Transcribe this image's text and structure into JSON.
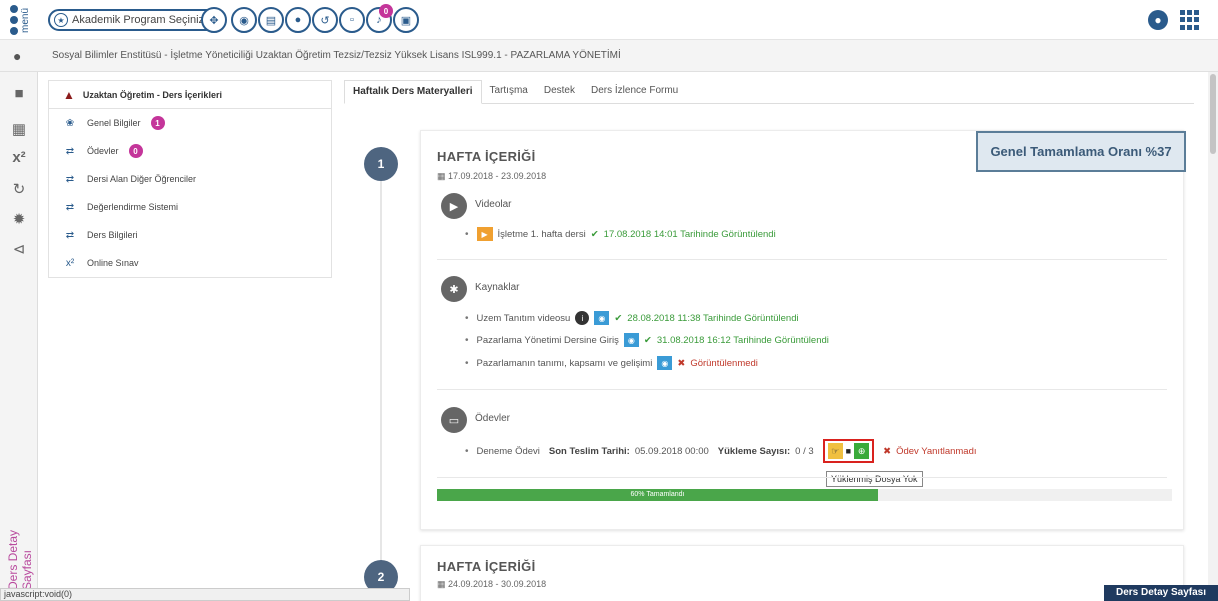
{
  "topbar": {
    "menu_label": "menü",
    "program_select_label": "Akademik Program Seçiniz",
    "notification_count": "0"
  },
  "breadcrumb": "Sosyal Bilimler Enstitüsü - İşletme Yöneticiliği Uzaktan Öğretim Tezsiz/Tezsiz Yüksek Lisans ISL999.1 - PAZARLAMA YÖNETİMİ",
  "rail": {
    "vertical_label": "Ders Detay Sayfası"
  },
  "course_nav": {
    "header": "Uzaktan Öğretim - Ders İçerikleri",
    "items": [
      {
        "label": "Genel Bilgiler",
        "badge": "1"
      },
      {
        "label": "Ödevler",
        "badge": "0"
      },
      {
        "label": "Dersi Alan Diğer Öğrenciler",
        "badge": ""
      },
      {
        "label": "Değerlendirme Sistemi",
        "badge": ""
      },
      {
        "label": "Ders Bilgileri",
        "badge": ""
      },
      {
        "label": "Online Sınav",
        "badge": ""
      }
    ]
  },
  "tabs": [
    {
      "label": "Haftalık Ders Materyalleri",
      "active": true
    },
    {
      "label": "Tartışma",
      "active": false
    },
    {
      "label": "Destek",
      "active": false
    },
    {
      "label": "Ders İzlence Formu",
      "active": false
    }
  ],
  "week1": {
    "number": "1",
    "title": "HAFTA İÇERİĞİ",
    "date_range": "17.09.2018 - 23.09.2018",
    "completion": "Genel Tamamlama Oranı %37",
    "videos_title": "Videolar",
    "video_item": {
      "label": "İşletme 1. hafta dersi",
      "status": "17.08.2018 14:01 Tarihinde Görüntülendi"
    },
    "resources_title": "Kaynaklar",
    "resources": [
      {
        "label": "Uzem Tanıtım videosu",
        "status": "28.08.2018 11:38 Tarihinde Görüntülendi"
      },
      {
        "label": "Pazarlama Yönetimi Dersine Giriş",
        "status": "31.08.2018 16:12 Tarihinde Görüntülendi"
      },
      {
        "label": "Pazarlamanın tanımı, kapsamı ve gelişimi",
        "status": "Görüntülenmedi"
      }
    ],
    "assignments_title": "Ödevler",
    "assignment": {
      "label": "Deneme Ödevi",
      "deadline_label": "Son Teslim Tarihi:",
      "deadline": "05.09.2018 00:00",
      "uploads_label": "Yükleme Sayısı:",
      "uploads": "0 / 3",
      "status": "Ödev Yanıtlanmadı",
      "tooltip": "Yüklenmiş Dosya Yok"
    },
    "progress_label": "60% Tamamlandı",
    "progress_fraction": 0.6
  },
  "week2": {
    "number": "2",
    "title": "HAFTA İÇERİĞİ",
    "date_range": "24.09.2018 - 30.09.2018"
  },
  "statusbar": "javascript:void(0)",
  "footer_label": "Ders Detay Sayfası"
}
